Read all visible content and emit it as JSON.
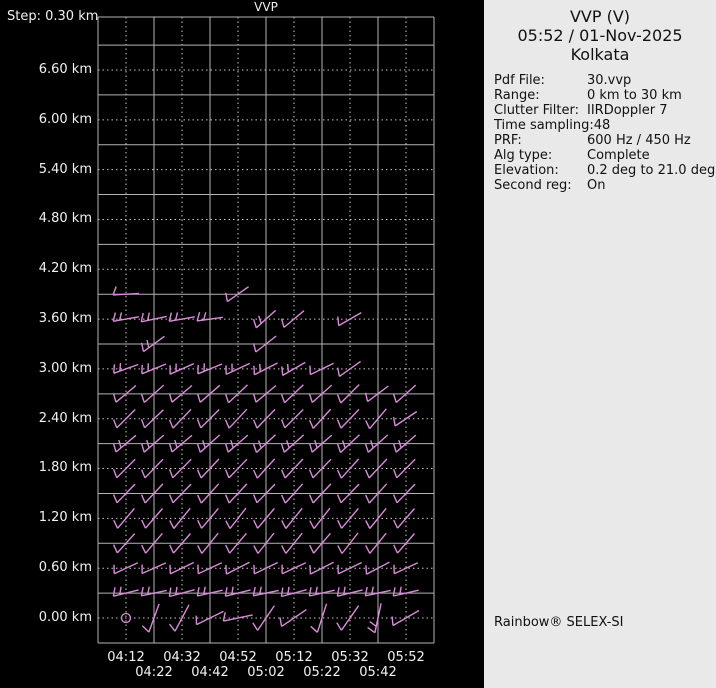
{
  "window": {
    "left_bg": "#000000",
    "right_bg": "#e9e9e9",
    "accent_barb_color": "#d88cd8",
    "grid_color": "#b4b4b4"
  },
  "chart": {
    "title": "VVP",
    "step_label": "Step: 0.30 km",
    "y_ticks": [
      "6.60 km",
      "6.00 km",
      "5.40 km",
      "4.80 km",
      "4.20 km",
      "3.60 km",
      "3.00 km",
      "2.40 km",
      "1.80 km",
      "1.20 km",
      "0.60 km",
      "0.00 km"
    ],
    "x_ticks": [
      "04:12",
      "04:22",
      "04:32",
      "04:42",
      "04:52",
      "05:02",
      "05:12",
      "05:22",
      "05:32",
      "05:42",
      "05:52"
    ]
  },
  "info_panel": {
    "title": "VVP (V)",
    "datetime": "05:52 / 01-Nov-2025",
    "site": "Kolkata",
    "fields": [
      {
        "label": "Pdf File:",
        "value": "30.vvp"
      },
      {
        "label": "Range:",
        "value": "0 km to 30 km"
      },
      {
        "label": "Clutter Filter:",
        "value": "IIRDoppler 7"
      },
      {
        "label": "Time sampling:",
        "value": "48"
      },
      {
        "label": "PRF:",
        "value": "600 Hz / 450 Hz"
      },
      {
        "label": "Alg type:",
        "value": "Complete"
      },
      {
        "label": "Elevation:",
        "value": "0.2 deg to 21.0 deg"
      },
      {
        "label": "Second reg:",
        "value": "On"
      }
    ],
    "footer": "Rainbow® SELEX-SI"
  },
  "chart_data": {
    "type": "wind-barb-time-height-profile",
    "title": "VVP",
    "x_times": [
      "04:12",
      "04:22",
      "04:32",
      "04:42",
      "04:52",
      "05:02",
      "05:12",
      "05:22",
      "05:32",
      "05:42",
      "05:52"
    ],
    "height_step_km": 0.3,
    "y_axis_km": [
      6.6,
      6.0,
      5.4,
      4.8,
      4.2,
      3.6,
      3.0,
      2.4,
      1.8,
      1.2,
      0.6,
      0.0
    ],
    "barb_color": "#d88cd8",
    "note": "barbs: t=time index, a=staff angle deg above horizontal (pointing up-right), f=feather ticks; calm=circle symbol",
    "rows": [
      {
        "km": 3.9,
        "barbs": [
          {
            "t": 0,
            "a": 3,
            "f": 1
          },
          {
            "t": 4,
            "a": 35,
            "f": 1
          }
        ]
      },
      {
        "km": 3.6,
        "barbs": [
          {
            "t": 0,
            "a": 10,
            "f": 2
          },
          {
            "t": 1,
            "a": 12,
            "f": 2
          },
          {
            "t": 2,
            "a": 10,
            "f": 2
          },
          {
            "t": 3,
            "a": 8,
            "f": 2
          },
          {
            "t": 5,
            "a": 42,
            "f": 2
          },
          {
            "t": 6,
            "a": 40,
            "f": 1
          },
          {
            "t": 8,
            "a": 30,
            "f": 1
          }
        ]
      },
      {
        "km": 3.3,
        "barbs": [
          {
            "t": 1,
            "a": 36,
            "f": 2
          },
          {
            "t": 5,
            "a": 38,
            "f": 1
          }
        ]
      },
      {
        "km": 3.0,
        "barbs": [
          {
            "t": 0,
            "a": 20,
            "f": 2
          },
          {
            "t": 1,
            "a": 22,
            "f": 2
          },
          {
            "t": 2,
            "a": 24,
            "f": 2
          },
          {
            "t": 3,
            "a": 22,
            "f": 2
          },
          {
            "t": 4,
            "a": 25,
            "f": 2
          },
          {
            "t": 5,
            "a": 27,
            "f": 2
          },
          {
            "t": 6,
            "a": 30,
            "f": 2
          },
          {
            "t": 7,
            "a": 26,
            "f": 1
          },
          {
            "t": 8,
            "a": 35,
            "f": 1
          }
        ]
      },
      {
        "km": 2.7,
        "barbs": [
          {
            "t": 0,
            "a": 40,
            "f": 1
          },
          {
            "t": 1,
            "a": 42,
            "f": 1
          },
          {
            "t": 2,
            "a": 40,
            "f": 1
          },
          {
            "t": 3,
            "a": 41,
            "f": 1
          },
          {
            "t": 4,
            "a": 43,
            "f": 1
          },
          {
            "t": 5,
            "a": 40,
            "f": 1
          },
          {
            "t": 6,
            "a": 44,
            "f": 1
          },
          {
            "t": 7,
            "a": 42,
            "f": 1
          },
          {
            "t": 8,
            "a": 45,
            "f": 1
          },
          {
            "t": 9,
            "a": 37,
            "f": 1
          },
          {
            "t": 10,
            "a": 42,
            "f": 1
          }
        ]
      },
      {
        "km": 2.4,
        "barbs": [
          {
            "t": 0,
            "a": 45,
            "f": 1
          },
          {
            "t": 1,
            "a": 44,
            "f": 1
          },
          {
            "t": 2,
            "a": 46,
            "f": 1
          },
          {
            "t": 3,
            "a": 45,
            "f": 1
          },
          {
            "t": 4,
            "a": 47,
            "f": 1
          },
          {
            "t": 5,
            "a": 46,
            "f": 1
          },
          {
            "t": 6,
            "a": 45,
            "f": 1
          },
          {
            "t": 7,
            "a": 48,
            "f": 1
          },
          {
            "t": 8,
            "a": 46,
            "f": 1
          },
          {
            "t": 9,
            "a": 50,
            "f": 1
          },
          {
            "t": 10,
            "a": 34,
            "f": 1
          }
        ]
      },
      {
        "km": 2.1,
        "barbs": [
          {
            "t": 0,
            "a": 40,
            "f": 2
          },
          {
            "t": 1,
            "a": 41,
            "f": 2
          },
          {
            "t": 2,
            "a": 40,
            "f": 2
          },
          {
            "t": 3,
            "a": 42,
            "f": 2
          },
          {
            "t": 4,
            "a": 41,
            "f": 2
          },
          {
            "t": 5,
            "a": 43,
            "f": 2
          },
          {
            "t": 6,
            "a": 42,
            "f": 2
          },
          {
            "t": 7,
            "a": 41,
            "f": 2
          },
          {
            "t": 8,
            "a": 43,
            "f": 2
          },
          {
            "t": 9,
            "a": 42,
            "f": 2
          },
          {
            "t": 10,
            "a": 41,
            "f": 2
          }
        ]
      },
      {
        "km": 1.8,
        "barbs": [
          {
            "t": 0,
            "a": 45,
            "f": 1
          },
          {
            "t": 1,
            "a": 46,
            "f": 1
          },
          {
            "t": 2,
            "a": 45,
            "f": 1
          },
          {
            "t": 3,
            "a": 47,
            "f": 1
          },
          {
            "t": 4,
            "a": 46,
            "f": 1
          },
          {
            "t": 5,
            "a": 48,
            "f": 1
          },
          {
            "t": 6,
            "a": 47,
            "f": 1
          },
          {
            "t": 7,
            "a": 46,
            "f": 1
          },
          {
            "t": 8,
            "a": 48,
            "f": 1
          },
          {
            "t": 9,
            "a": 47,
            "f": 1
          },
          {
            "t": 10,
            "a": 45,
            "f": 1
          }
        ]
      },
      {
        "km": 1.5,
        "barbs": [
          {
            "t": 0,
            "a": 46,
            "f": 1
          },
          {
            "t": 1,
            "a": 47,
            "f": 1
          },
          {
            "t": 2,
            "a": 46,
            "f": 1
          },
          {
            "t": 3,
            "a": 48,
            "f": 1
          },
          {
            "t": 4,
            "a": 47,
            "f": 1
          },
          {
            "t": 5,
            "a": 46,
            "f": 1
          },
          {
            "t": 6,
            "a": 48,
            "f": 1
          },
          {
            "t": 7,
            "a": 47,
            "f": 1
          },
          {
            "t": 8,
            "a": 46,
            "f": 1
          },
          {
            "t": 9,
            "a": 48,
            "f": 1
          },
          {
            "t": 10,
            "a": 46,
            "f": 1
          }
        ]
      },
      {
        "km": 1.2,
        "barbs": [
          {
            "t": 0,
            "a": 50,
            "f": 1
          },
          {
            "t": 1,
            "a": 49,
            "f": 1
          },
          {
            "t": 2,
            "a": 51,
            "f": 1
          },
          {
            "t": 3,
            "a": 50,
            "f": 1
          },
          {
            "t": 4,
            "a": 52,
            "f": 1
          },
          {
            "t": 5,
            "a": 50,
            "f": 1
          },
          {
            "t": 6,
            "a": 51,
            "f": 1
          },
          {
            "t": 7,
            "a": 52,
            "f": 1
          },
          {
            "t": 8,
            "a": 50,
            "f": 1
          },
          {
            "t": 9,
            "a": 51,
            "f": 1
          },
          {
            "t": 10,
            "a": 49,
            "f": 1
          }
        ]
      },
      {
        "km": 0.9,
        "barbs": [
          {
            "t": 0,
            "a": 48,
            "f": 1
          },
          {
            "t": 1,
            "a": 50,
            "f": 1
          },
          {
            "t": 2,
            "a": 49,
            "f": 1
          },
          {
            "t": 3,
            "a": 51,
            "f": 1
          },
          {
            "t": 4,
            "a": 50,
            "f": 1
          },
          {
            "t": 5,
            "a": 52,
            "f": 1
          },
          {
            "t": 6,
            "a": 51,
            "f": 1
          },
          {
            "t": 7,
            "a": 50,
            "f": 1
          },
          {
            "t": 8,
            "a": 52,
            "f": 1
          },
          {
            "t": 9,
            "a": 51,
            "f": 1
          },
          {
            "t": 10,
            "a": 49,
            "f": 1
          }
        ]
      },
      {
        "km": 0.6,
        "barbs": [
          {
            "t": 0,
            "a": 25,
            "f": 1
          },
          {
            "t": 1,
            "a": 24,
            "f": 1
          },
          {
            "t": 2,
            "a": 26,
            "f": 1
          },
          {
            "t": 3,
            "a": 25,
            "f": 1
          },
          {
            "t": 4,
            "a": 27,
            "f": 1
          },
          {
            "t": 5,
            "a": 26,
            "f": 1
          },
          {
            "t": 6,
            "a": 25,
            "f": 1
          },
          {
            "t": 7,
            "a": 27,
            "f": 1
          },
          {
            "t": 8,
            "a": 26,
            "f": 1
          },
          {
            "t": 9,
            "a": 28,
            "f": 1
          },
          {
            "t": 10,
            "a": 25,
            "f": 1
          }
        ]
      },
      {
        "km": 0.3,
        "barbs": [
          {
            "t": 0,
            "a": 14,
            "f": 2
          },
          {
            "t": 1,
            "a": 12,
            "f": 2
          },
          {
            "t": 2,
            "a": 15,
            "f": 2
          },
          {
            "t": 3,
            "a": 13,
            "f": 2
          },
          {
            "t": 4,
            "a": 14,
            "f": 2
          },
          {
            "t": 5,
            "a": 12,
            "f": 2
          },
          {
            "t": 6,
            "a": 15,
            "f": 2
          },
          {
            "t": 7,
            "a": 13,
            "f": 2
          },
          {
            "t": 8,
            "a": 14,
            "f": 2
          },
          {
            "t": 9,
            "a": 12,
            "f": 2
          },
          {
            "t": 10,
            "a": 13,
            "f": 2
          }
        ]
      },
      {
        "km": 0.0,
        "barbs": [
          {
            "t": 0,
            "calm": true
          },
          {
            "t": 1,
            "a": 70,
            "f": 1
          },
          {
            "t": 2,
            "a": 62,
            "f": 1
          },
          {
            "t": 3,
            "a": 26,
            "f": 1
          },
          {
            "t": 4,
            "a": 12,
            "f": 1
          },
          {
            "t": 5,
            "a": 56,
            "f": 1
          },
          {
            "t": 6,
            "a": 34,
            "f": 1
          },
          {
            "t": 7,
            "a": 72,
            "f": 1
          },
          {
            "t": 8,
            "a": 55,
            "f": 1
          },
          {
            "t": 9,
            "a": 78,
            "f": 2
          },
          {
            "t": 10,
            "a": 30,
            "f": 1
          }
        ]
      }
    ]
  }
}
